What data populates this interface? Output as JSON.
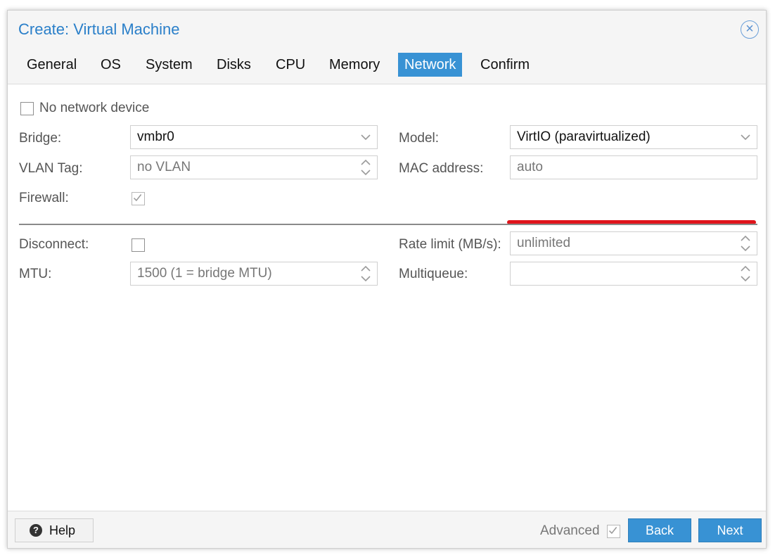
{
  "window": {
    "title": "Create: Virtual Machine"
  },
  "tabs": [
    {
      "label": "General"
    },
    {
      "label": "OS"
    },
    {
      "label": "System"
    },
    {
      "label": "Disks"
    },
    {
      "label": "CPU"
    },
    {
      "label": "Memory"
    },
    {
      "label": "Network",
      "active": true
    },
    {
      "label": "Confirm"
    }
  ],
  "form": {
    "no_network_device_label": "No network device",
    "bridge": {
      "label": "Bridge:",
      "value": "vmbr0"
    },
    "vlan_tag": {
      "label": "VLAN Tag:",
      "placeholder": "no VLAN"
    },
    "firewall": {
      "label": "Firewall:",
      "checked": true
    },
    "model": {
      "label": "Model:",
      "value": "VirtIO (paravirtualized)"
    },
    "mac_address": {
      "label": "MAC address:",
      "placeholder": "auto"
    },
    "disconnect": {
      "label": "Disconnect:",
      "checked": false
    },
    "mtu": {
      "label": "MTU:",
      "placeholder": "1500 (1 = bridge MTU)"
    },
    "rate_limit": {
      "label": "Rate limit (MB/s):",
      "placeholder": "unlimited"
    },
    "multiqueue": {
      "label": "Multiqueue:",
      "value": ""
    }
  },
  "footer": {
    "help_label": "Help",
    "advanced_label": "Advanced",
    "advanced_checked": true,
    "back_label": "Back",
    "next_label": "Next"
  },
  "colors": {
    "accent": "#3892d4",
    "title": "#2a7fc9",
    "annotation": "#e0141b"
  },
  "icons": [
    "close-circle-icon",
    "chevron-down-icon",
    "spinner-arrows-icon",
    "checkmark-icon",
    "question-circle-icon"
  ]
}
